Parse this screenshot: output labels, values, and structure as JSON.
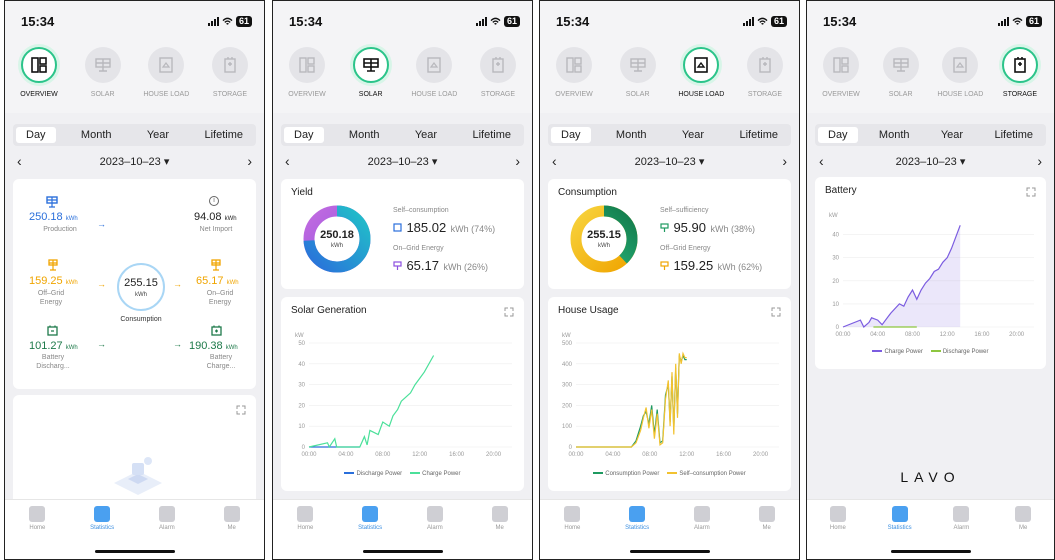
{
  "status": {
    "time": "15:34",
    "battery": "61"
  },
  "categories": [
    "OVERVIEW",
    "SOLAR",
    "HOUSE LOAD",
    "STORAGE"
  ],
  "tabs": [
    "Day",
    "Month",
    "Year",
    "Lifetime"
  ],
  "date": "2023–10–23 ▾",
  "nav": [
    "Home",
    "Statistics",
    "Alarm",
    "Me"
  ],
  "overview": {
    "production_value": "250.18",
    "production_unit": "kWh",
    "production_label": "Production",
    "net_import_value": "94.08",
    "net_import_unit": "kWh",
    "net_import_label": "Net Import",
    "offgrid_value": "159.25",
    "offgrid_unit": "kWh",
    "offgrid_label1": "Off–Grid",
    "offgrid_label2": "Energy",
    "ongrid_value": "65.17",
    "ongrid_unit": "kWh",
    "ongrid_label1": "On–Grid",
    "ongrid_label2": "Energy",
    "consumption_value": "255.15",
    "consumption_unit": "kWh",
    "consumption_label": "Consumption",
    "battery_dis_value": "101.27",
    "battery_dis_unit": "kWh",
    "battery_dis_label1": "Battery",
    "battery_dis_label2": "Discharg...",
    "battery_chg_value": "190.38",
    "battery_chg_unit": "kWh",
    "battery_chg_label1": "Battery",
    "battery_chg_label2": "Charge..."
  },
  "solar": {
    "yield_title": "Yield",
    "donut_value": "250.18",
    "donut_unit": "kWh",
    "self_label": "Self–consumption",
    "self_value": "185.02",
    "self_suffix": "kWh (74%)",
    "self_fraction": 0.74,
    "ongrid_label": "On–Grid Energy",
    "ongrid_value": "65.17",
    "ongrid_suffix": "kWh (26%)",
    "chart_title": "Solar Generation",
    "legend": [
      "Discharge Power",
      "Charge Power"
    ]
  },
  "house": {
    "consumption_title": "Consumption",
    "donut_value": "255.15",
    "donut_unit": "kWh",
    "self_label": "Self–sufficiency",
    "self_value": "95.90",
    "self_suffix": "kWh (38%)",
    "self_fraction": 0.38,
    "offgrid_label": "Off–Grid Energy",
    "offgrid_value": "159.25",
    "offgrid_suffix": "kWh (62%)",
    "chart_title": "House Usage",
    "legend": [
      "Consumption Power",
      "Self–consumption Power"
    ]
  },
  "storage": {
    "chart_title": "Battery",
    "legend": [
      "Charge Power",
      "Discharge Power"
    ],
    "brand": "LAVO"
  },
  "colors": {
    "green": "#2bc48a",
    "blue": "#2a6fdb",
    "orange": "#f0a500",
    "purple": "#7b5ce0",
    "teal": "#21c1c8",
    "lightgreen": "#4be09a",
    "olive": "#8dc63f",
    "yellow": "#f2c230"
  },
  "chart_data": [
    {
      "type": "line",
      "title": "Solar Generation",
      "ylabel": "kW",
      "x_ticks": [
        "00:00",
        "04:00",
        "08:00",
        "12:00",
        "16:00",
        "20:00"
      ],
      "ylim": [
        0,
        50
      ],
      "series": [
        {
          "name": "Discharge Power",
          "x": [
            0,
            5.5
          ],
          "y": [
            0,
            0
          ]
        },
        {
          "name": "Charge Power",
          "x": [
            0,
            2,
            2.2,
            2.8,
            3,
            5.5,
            6,
            6.3,
            6.6,
            7.5,
            8,
            8.7,
            9.1,
            9.6,
            10,
            10.5,
            11,
            11.5,
            12,
            12.5,
            13.5
          ],
          "y": [
            0,
            2,
            0,
            4,
            0,
            0,
            5,
            1,
            8,
            6,
            12,
            10,
            15,
            18,
            22,
            24,
            26,
            30,
            33,
            36,
            44
          ]
        }
      ]
    },
    {
      "type": "line",
      "title": "House Usage",
      "ylabel": "kW",
      "x_ticks": [
        "00:00",
        "04:00",
        "08:00",
        "12:00",
        "16:00",
        "20:00"
      ],
      "ylim": [
        0,
        500
      ],
      "series": [
        {
          "name": "Consumption Power",
          "x": [
            0,
            6,
            6.5,
            7,
            7.3,
            7.6,
            7.9,
            8.2,
            8.5,
            8.8,
            9.1,
            9.4,
            9.7,
            10,
            10.2,
            10.4,
            10.6,
            10.8,
            11,
            11.2,
            11.4,
            11.6,
            11.8,
            12
          ],
          "y": [
            0,
            0,
            30,
            100,
            150,
            170,
            110,
            200,
            60,
            180,
            20,
            30,
            250,
            300,
            120,
            340,
            80,
            380,
            160,
            440,
            410,
            440,
            420,
            420
          ]
        },
        {
          "name": "Self–consumption Power",
          "x": [
            0,
            6,
            6.5,
            7,
            7.3,
            7.6,
            7.9,
            8.2,
            8.5,
            8.8,
            9.1,
            9.4,
            9.7,
            10,
            10.2,
            10.4,
            10.6,
            10.8,
            11,
            11.2,
            11.4,
            11.6,
            11.8,
            12
          ],
          "y": [
            0,
            0,
            20,
            80,
            140,
            190,
            90,
            180,
            40,
            160,
            10,
            20,
            230,
            320,
            100,
            360,
            60,
            400,
            140,
            450,
            400,
            450,
            430,
            430
          ]
        }
      ]
    },
    {
      "type": "area",
      "title": "Battery",
      "ylabel": "kW",
      "x_ticks": [
        "00:00",
        "04:00",
        "08:00",
        "12:00",
        "16:00",
        "20:00"
      ],
      "ylim": [
        0,
        45
      ],
      "series": [
        {
          "name": "Charge Power",
          "x": [
            0,
            2,
            2.4,
            3,
            3.3,
            4,
            4.5,
            5.5,
            6.5,
            7,
            7.5,
            8,
            8.5,
            9,
            9.5,
            10,
            10.5,
            11,
            11.5,
            12,
            12.5,
            13.5
          ],
          "y": [
            0,
            3,
            0,
            2,
            4,
            3,
            1,
            6,
            10,
            9,
            13,
            16,
            12,
            16,
            19,
            21,
            24,
            25,
            28,
            30,
            34,
            44
          ]
        },
        {
          "name": "Discharge Power",
          "x": [
            3.5,
            8.5
          ],
          "y": [
            0,
            0
          ]
        }
      ]
    }
  ]
}
